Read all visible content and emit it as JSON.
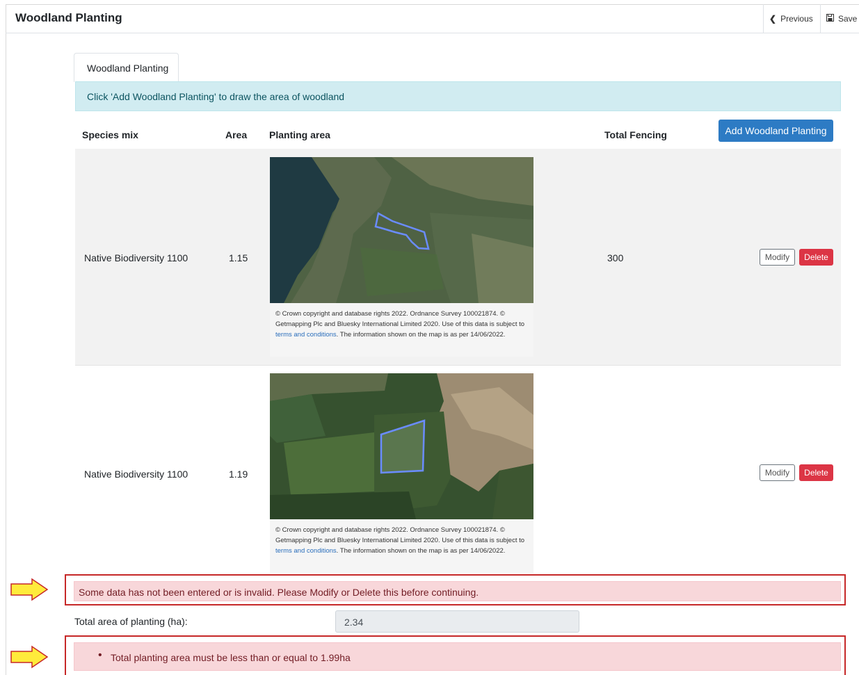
{
  "header": {
    "title": "Woodland Planting",
    "previous_label": "Previous",
    "save_label": "Save"
  },
  "tab": {
    "label": "Woodland Planting"
  },
  "info": {
    "text": "Click 'Add Woodland Planting' to draw the area of woodland"
  },
  "table": {
    "columns": [
      "Species mix",
      "Area",
      "Planting area",
      "Total Fencing"
    ],
    "add_button": "Add Woodland Planting",
    "rows": [
      {
        "species": "Native Biodiversity 1100",
        "area": "1.15",
        "fencing": "300",
        "caption_pre": "© Crown copyright and database rights 2022. Ordnance Survey 100021874. © Getmapping Plc and Bluesky International Limited 2020. Use of this data is subject to ",
        "caption_link": "terms and conditions",
        "caption_post": ". The information shown on the map is as per 14/06/2022.",
        "modify": "Modify",
        "delete": "Delete"
      },
      {
        "species": "Native Biodiversity 1100",
        "area": "1.19",
        "fencing": "",
        "caption_pre": "© Crown copyright and database rights 2022. Ordnance Survey 100021874. © Getmapping Plc and Bluesky International Limited 2020. Use of this data is subject to ",
        "caption_link": "terms and conditions",
        "caption_post": ". The information shown on the map is as per 14/06/2022.",
        "modify": "Modify",
        "delete": "Delete"
      }
    ]
  },
  "errors": {
    "invalid_data": "Some data has not been entered or is invalid. Please Modify or Delete this before continuing.",
    "area_limit": "Total planting area must be less than or equal to 1.99ha"
  },
  "total": {
    "label": "Total area of planting (ha):",
    "value": "2.34"
  },
  "icons": {
    "previous": "chevron-left-icon",
    "save": "floppy-disk-icon",
    "callout": "arrow-right-icon"
  },
  "colors": {
    "primary": "#2d7bc4",
    "danger": "#dc3545",
    "info_bg": "#d1ecf1",
    "error_bg": "#f8d7da",
    "highlight": "#c62828",
    "callout_arrow": "#ffeb3b"
  }
}
